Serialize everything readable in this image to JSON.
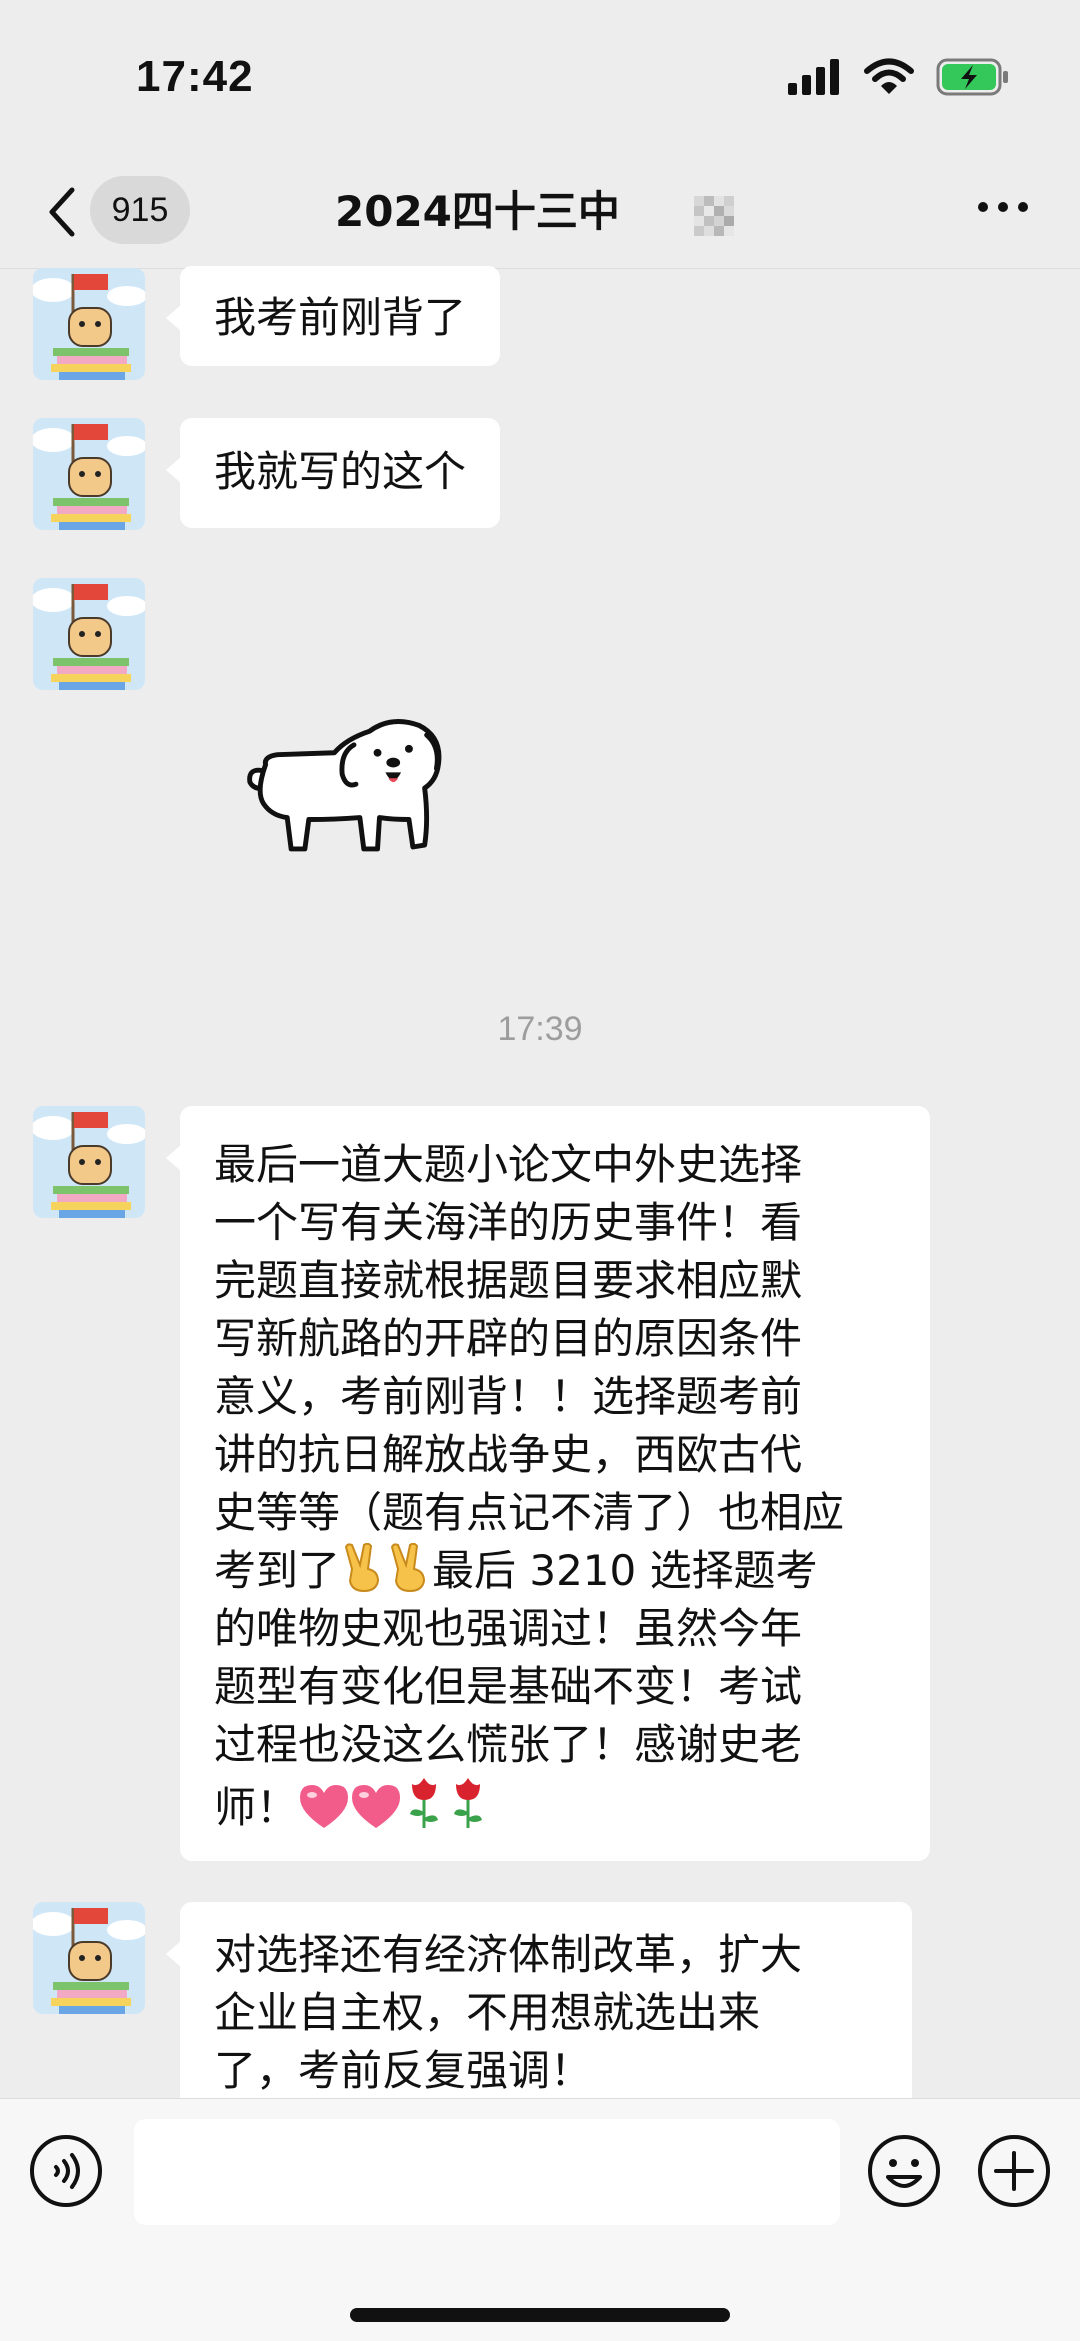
{
  "status_bar": {
    "time": "17:42"
  },
  "nav": {
    "back_badge": "915",
    "title": "2024四十三中"
  },
  "messages": [
    {
      "type": "text",
      "lines": [
        "我考前刚背了"
      ]
    },
    {
      "type": "text",
      "lines": [
        "我就写的这个"
      ]
    },
    {
      "type": "sticker",
      "sticker": "white-puppy-sticker"
    },
    {
      "type": "timestamp",
      "text": "17:39"
    },
    {
      "type": "text",
      "lines": [
        "最后一道大题小论文中外史选择",
        "一个写有关海洋的历史事件！看",
        "完题直接就根据题目要求相应默",
        "写新航路的开辟的目的原因条件",
        "意义，考前刚背！！选择题考前",
        "讲的抗日解放战争史，西欧古代",
        "史等等（题有点记不清了）也相应",
        "考到了",
        "最后 3210 选择题考",
        "的唯物史观也强调过！虽然今年",
        "题型有变化但是基础不变！考试",
        "过程也没这么慌张了！感谢史老",
        "师！"
      ]
    },
    {
      "type": "text",
      "lines": [
        "对选择还有经济体制改革，扩大",
        "企业自主权，不用想就选出来",
        "了，考前反复强调！"
      ]
    }
  ],
  "icons": {
    "victory_hand": "victory-hand-emoji",
    "heart": "pink-heart-emoji",
    "rose": "rose-emoji"
  },
  "colors": {
    "background": "#ededed",
    "bubble": "#ffffff",
    "badge": "#d9d9d9",
    "battery": "#34c759",
    "timestamp": "#9d9d9d"
  }
}
